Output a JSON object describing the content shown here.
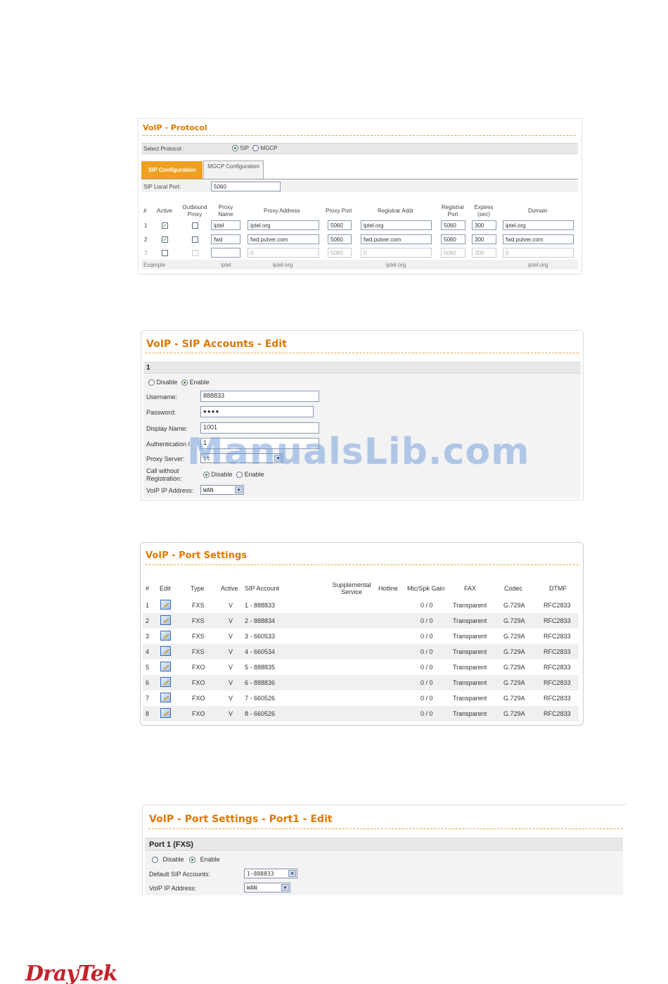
{
  "protocol": {
    "title": "VoIP - Protocol",
    "select_label": "Select Protocol :",
    "options": [
      "SIP",
      "MGCP"
    ],
    "tabs": [
      "SIP Configuration",
      "MGCP Configuration"
    ],
    "local_port_label": "SIP Local Port:",
    "local_port_value": "5060",
    "headers": [
      "#",
      "Active",
      "Outbound Proxy",
      "Proxy Name",
      "Proxy Address",
      "Proxy Port",
      "Registrar Addr",
      "Registrar Port",
      "Expires (sec)",
      "Domain"
    ],
    "rows": [
      {
        "num": "1",
        "active": "✓",
        "proxy_name": "iptel",
        "proxy_addr": "iptel.org",
        "proxy_port": "5060",
        "reg_addr": "iptel.org",
        "reg_port": "5060",
        "expires": "300",
        "domain": "iptel.org"
      },
      {
        "num": "2",
        "active": "✓",
        "proxy_name": "fwd",
        "proxy_addr": "fwd.pulver.com",
        "proxy_port": "5060",
        "reg_addr": "fwd.pulver.com",
        "reg_port": "5060",
        "expires": "300",
        "domain": "fwd.pulver.com"
      },
      {
        "num": "3",
        "active": "",
        "proxy_name": "",
        "proxy_addr": "0",
        "proxy_port": "5060",
        "reg_addr": "0",
        "reg_port": "5060",
        "expires": "300",
        "domain": "0"
      }
    ],
    "example": {
      "label": "Example",
      "proxy_name": "iptel",
      "proxy_addr": "iptel.org",
      "reg_addr": "iptel.org",
      "domain": "iptel.org"
    }
  },
  "sip_edit": {
    "title": "VoIP - SIP Accounts - Edit",
    "index": "1",
    "disable": "Disable",
    "enable": "Enable",
    "username_label": "Username:",
    "username": "888833",
    "password_label": "Password:",
    "password": "●●●●",
    "display_label": "Display Name:",
    "display": "1001",
    "auth_label": "Authentication I",
    "auth": "1",
    "proxy_label": "Proxy Server:",
    "proxy": "it",
    "call_label_1": "Call without",
    "call_label_2": "Registration:",
    "call_disable": "Disable",
    "call_enable": "Enable",
    "voip_ip_label": "VoIP IP Address:",
    "voip_ip": "WAN"
  },
  "watermark": "ManualsLib.com",
  "ports": {
    "title": "VoIP - Port Settings",
    "headers": [
      "#",
      "Edit",
      "Type",
      "Active",
      "SIP Account",
      "Supplemental Service",
      "Hotline",
      "Mic/Spk Gain",
      "FAX",
      "Codec",
      "DTMF"
    ],
    "rows": [
      {
        "num": "1",
        "type": "FXS",
        "active": "V",
        "account": "1 - 888833",
        "gain": "0 / 0",
        "fax": "Transparent",
        "codec": "G.729A",
        "dtmf": "RFC2833"
      },
      {
        "num": "2",
        "type": "FXS",
        "active": "V",
        "account": "2 - 888834",
        "gain": "0 / 0",
        "fax": "Transparent",
        "codec": "G.729A",
        "dtmf": "RFC2833"
      },
      {
        "num": "3",
        "type": "FXS",
        "active": "V",
        "account": "3 - 660533",
        "gain": "0 / 0",
        "fax": "Transparent",
        "codec": "G.729A",
        "dtmf": "RFC2833"
      },
      {
        "num": "4",
        "type": "FXS",
        "active": "V",
        "account": "4 - 660534",
        "gain": "0 / 0",
        "fax": "Transparent",
        "codec": "G.729A",
        "dtmf": "RFC2833"
      },
      {
        "num": "5",
        "type": "FXO",
        "active": "V",
        "account": "5 - 888835",
        "gain": "0 / 0",
        "fax": "Transparent",
        "codec": "G.729A",
        "dtmf": "RFC2833"
      },
      {
        "num": "6",
        "type": "FXO",
        "active": "V",
        "account": "6 - 888836",
        "gain": "0 / 0",
        "fax": "Transparent",
        "codec": "G.729A",
        "dtmf": "RFC2833"
      },
      {
        "num": "7",
        "type": "FXO",
        "active": "V",
        "account": "7 - 660526",
        "gain": "0 / 0",
        "fax": "Transparent",
        "codec": "G.729A",
        "dtmf": "RFC2833"
      },
      {
        "num": "8",
        "type": "FXO",
        "active": "V",
        "account": "8 - 660526",
        "gain": "0 / 0",
        "fax": "Transparent",
        "codec": "G.729A",
        "dtmf": "RFC2833"
      }
    ]
  },
  "port_edit": {
    "title": "VoIP - Port Settings - Port1 - Edit",
    "header": "Port 1 (FXS)",
    "disable": "Disable",
    "enable": "Enable",
    "default_sip_label": "Default SIP Accounts:",
    "default_sip": "1-888833",
    "voip_ip_label": "VoIP IP Address:",
    "voip_ip": "WAN"
  },
  "footer": {
    "logo": "DrayTek"
  }
}
